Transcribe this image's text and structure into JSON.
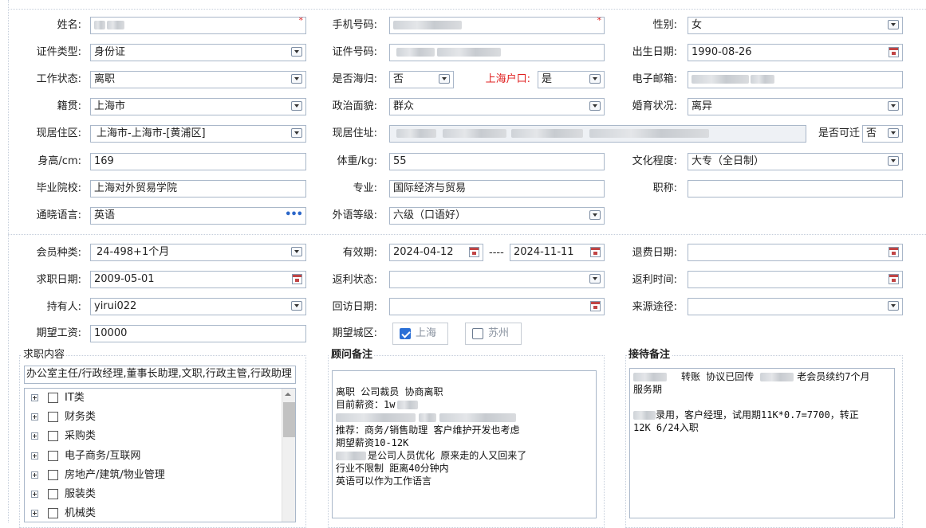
{
  "form": {
    "name": {
      "label": "姓名:"
    },
    "phone": {
      "label": "手机号码:"
    },
    "gender": {
      "label": "性别:",
      "value": "女"
    },
    "id_type": {
      "label": "证件类型:",
      "value": "身份证"
    },
    "id_number": {
      "label": "证件号码:"
    },
    "birth_date": {
      "label": "出生日期:",
      "value": "1990-08-26"
    },
    "work_status": {
      "label": "工作状态:",
      "value": "离职"
    },
    "returnee": {
      "label": "是否海归:",
      "value": "否"
    },
    "shanghai_hukou": {
      "label": "上海户口:",
      "value": "是"
    },
    "email": {
      "label": "电子邮箱:"
    },
    "native_place": {
      "label": "籍贯:",
      "value": "上海市"
    },
    "political": {
      "label": "政治面貌:",
      "value": "群众"
    },
    "marital": {
      "label": "婚育状况:",
      "value": "离异"
    },
    "residence_area": {
      "label": "现居住区:",
      "value": "上海市-上海市-[黄浦区]"
    },
    "residence_address": {
      "label": "现居住址:"
    },
    "relocate": {
      "label": "是否可迁",
      "value": "否"
    },
    "height": {
      "label": "身高/cm:",
      "value": "169"
    },
    "weight": {
      "label": "体重/kg:",
      "value": "55"
    },
    "education": {
      "label": "文化程度:",
      "value": "大专（全日制）"
    },
    "school": {
      "label": "毕业院校:",
      "value": "上海对外贸易学院"
    },
    "major": {
      "label": "专业:",
      "value": "国际经济与贸易"
    },
    "title": {
      "label": "职称:",
      "value": ""
    },
    "languages": {
      "label": "通晓语言:",
      "value": "英语"
    },
    "foreign_level": {
      "label": "外语等级:",
      "value": "六级（口语好）"
    },
    "member_type": {
      "label": "会员种类:",
      "value": "24-498+1个月"
    },
    "valid_period": {
      "label": "有效期:",
      "start": "2024-04-12",
      "sep": "----",
      "end": "2024-11-11"
    },
    "refund_date": {
      "label": "退费日期:",
      "value": ""
    },
    "job_date": {
      "label": "求职日期:",
      "value": "2009-05-01"
    },
    "rebate_status": {
      "label": "返利状态:",
      "value": ""
    },
    "rebate_time": {
      "label": "返利时间:",
      "value": ""
    },
    "holder": {
      "label": "持有人:",
      "value": "yirui022"
    },
    "revisit_date": {
      "label": "回访日期:",
      "value": ""
    },
    "source": {
      "label": "来源途径:",
      "value": ""
    },
    "salary": {
      "label": "期望工资:",
      "value": "10000"
    },
    "expected_city": {
      "label": "期望城区:",
      "options": [
        {
          "label": "上海",
          "checked": true
        },
        {
          "label": "苏州",
          "checked": false
        }
      ]
    }
  },
  "job_content": {
    "header": "求职内容",
    "summary": "办公室主任/行政经理,董事长助理,文职,行政主管,行政助理",
    "tree": [
      "IT类",
      "财务类",
      "采购类",
      "电子商务/互联网",
      "房地产/建筑/物业管理",
      "服装类",
      "机械类"
    ]
  },
  "consultant_notes": {
    "header": "顾问备注",
    "lines": [
      "",
      "离职 公司裁员  协商离职",
      "目前薪资：1w",
      "",
      "推荐：商务/销售助理 客户维护开发也考虑",
      "期望薪资10-12K",
      "是公司人员优化 原来走的人又回来了",
      "行业不限制 距离40分钟内",
      "英语可以作为工作语言"
    ]
  },
  "reception_notes": {
    "header": "接待备注",
    "lines": [
      "转账 协议已回传",
      "老会员续约7个月",
      "服务期",
      "录用，客户经理，试用期11K*0.7=7700，转正",
      "12K   6/24入职"
    ]
  },
  "icons": {
    "dropdown": "chevron-down-icon",
    "calendar": "calendar-icon",
    "more": "ellipsis-icon",
    "expand": "tree-expand-icon"
  },
  "colors": {
    "required": "#e02020",
    "checkbox_checked": "#2a6fd6",
    "border": "#a9b7c9"
  }
}
